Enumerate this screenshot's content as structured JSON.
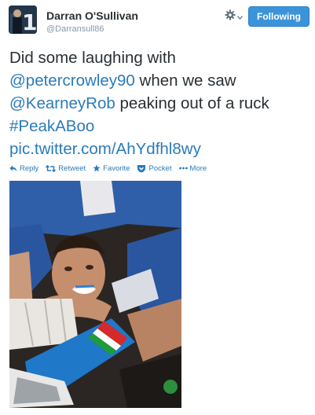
{
  "tweet": {
    "author_name": "Darran O'Sullivan",
    "author_handle": "@Darransull86",
    "follow_button_label": "Following",
    "text_plain_1": "Did some laughing with",
    "mention_1": "@petercrowley90",
    "text_plain_2": " when we saw",
    "mention_2": "@KearneyRob",
    "text_plain_3": " peaking out of a ruck",
    "hashtag": "#PeakABoo",
    "pic_link": "pic.twitter.com/AhYdfhl8wy"
  },
  "actions": [
    {
      "label": "Reply",
      "icon": "reply-icon"
    },
    {
      "label": "Retweet",
      "icon": "retweet-icon"
    },
    {
      "label": "Favorite",
      "icon": "star-icon"
    },
    {
      "label": "Pocket",
      "icon": "pocket-icon"
    },
    {
      "label": "More",
      "icon": "more-dots-icon"
    }
  ],
  "colors": {
    "link": "#2b7bb9",
    "follow_button": "#3b94d9",
    "text": "#292f33",
    "muted": "#8899a6"
  }
}
